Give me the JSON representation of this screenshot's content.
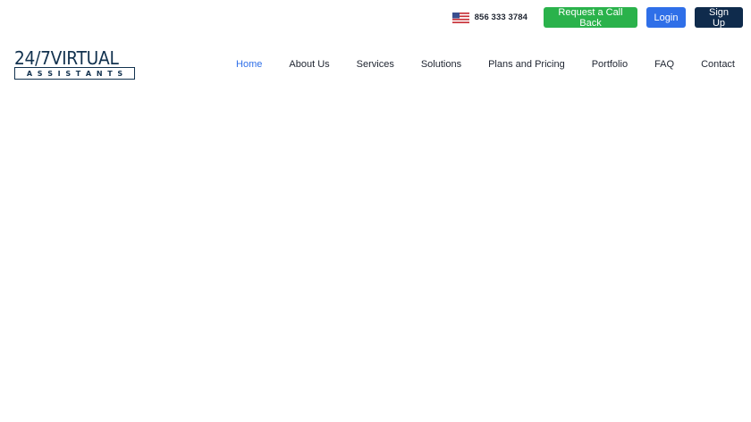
{
  "topbar": {
    "flag_icon": "us-flag-icon",
    "phone": "856 333 3784",
    "callback_label": "Request a Call Back",
    "login_label": "Login",
    "signup_label": "Sign Up",
    "colors": {
      "callback": "#2ab24b",
      "login": "#2f6fe8",
      "signup": "#0f2b4c"
    }
  },
  "logo": {
    "top_text": "24/7VIRTUAL",
    "bottom_letters": [
      "A",
      "S",
      "S",
      "I",
      "S",
      "T",
      "A",
      "N",
      "T",
      "S"
    ]
  },
  "nav": {
    "items": [
      {
        "label": "Home",
        "active": true
      },
      {
        "label": "About Us",
        "active": false
      },
      {
        "label": "Services",
        "active": false
      },
      {
        "label": "Solutions",
        "active": false
      },
      {
        "label": "Plans and Pricing",
        "active": false
      },
      {
        "label": "Portfolio",
        "active": false
      },
      {
        "label": "FAQ",
        "active": false
      },
      {
        "label": "Contact",
        "active": false
      }
    ],
    "active_color": "#2f6fe8"
  }
}
